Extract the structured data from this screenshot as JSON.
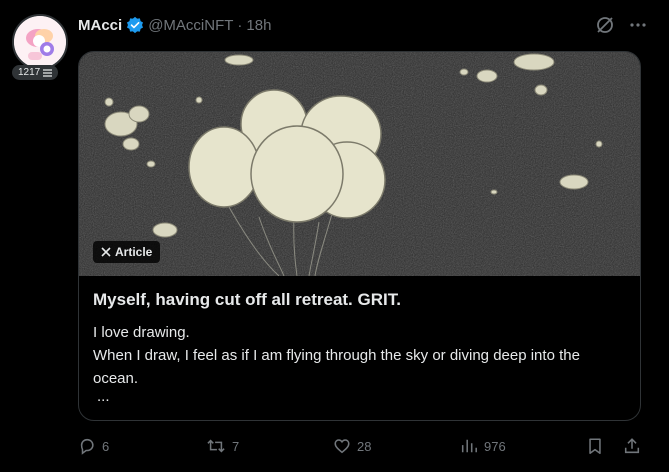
{
  "author": {
    "name": "MAcci",
    "handle": "@MAcciNFT",
    "separator": "·",
    "time": "18h",
    "verified_color": "#1d9bf0",
    "badge_count": "1217"
  },
  "header_icons": [
    "grok-icon",
    "more-icon"
  ],
  "article": {
    "chip_label": "Article",
    "title": "Myself, having cut off all retreat. GRIT.",
    "body_lines": [
      "I love drawing.",
      "When I draw, I feel as if I am flying through the sky or diving deep into the ocean."
    ],
    "ellipsis": "..."
  },
  "actions": {
    "replies": "6",
    "reposts": "7",
    "likes": "28",
    "views": "976"
  },
  "colors": {
    "background": "#000000",
    "text": "#e7e9ea",
    "muted": "#71767b",
    "border": "#2f3336",
    "balloon": "#e8e6cf"
  }
}
